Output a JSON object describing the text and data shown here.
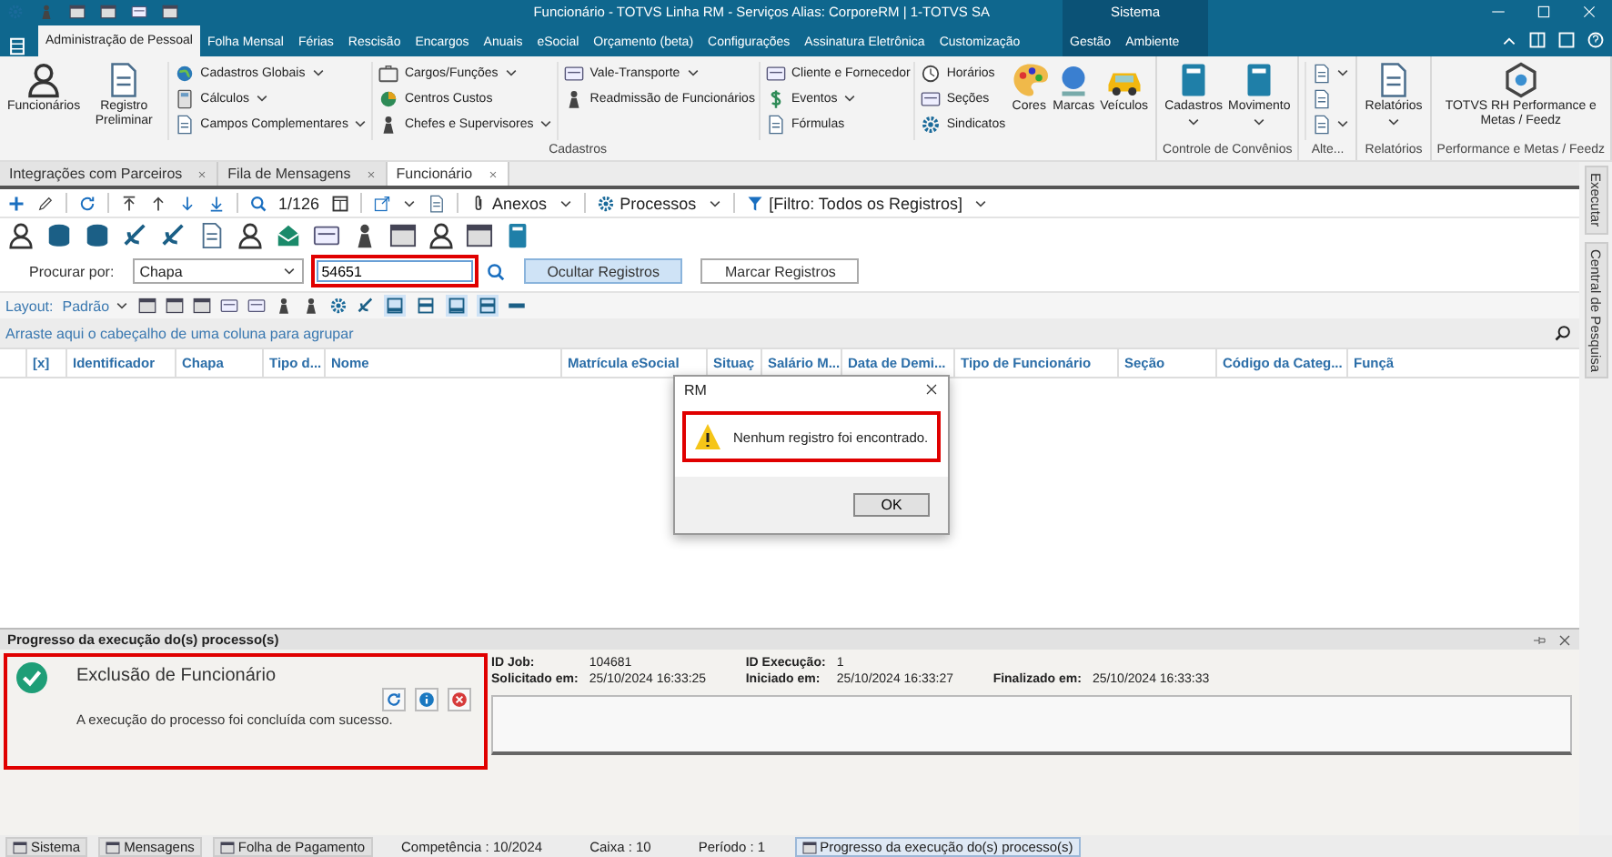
{
  "window": {
    "title": "Funcionário - TOTVS Linha RM - Serviços  Alias: CorporeRM | 1-TOTVS SA",
    "context_label": "Sistema"
  },
  "ribbon": {
    "tabs": [
      {
        "label": "Administração de Pessoal",
        "selected": true
      },
      {
        "label": "Folha Mensal",
        "selected": false
      },
      {
        "label": "Férias",
        "selected": false
      },
      {
        "label": "Rescisão",
        "selected": false
      },
      {
        "label": "Encargos",
        "selected": false
      },
      {
        "label": "Anuais",
        "selected": false
      },
      {
        "label": "eSocial",
        "selected": false
      },
      {
        "label": "Orçamento (beta)",
        "selected": false
      },
      {
        "label": "Configurações",
        "selected": false
      },
      {
        "label": "Assinatura Eletrônica",
        "selected": false
      },
      {
        "label": "Customização",
        "selected": false
      }
    ],
    "context_tabs": [
      {
        "label": "Gestão",
        "selected": false
      },
      {
        "label": "Ambiente",
        "selected": false
      }
    ],
    "groups": [
      {
        "label": "Cadastros",
        "columns": [
          {
            "kind": "large",
            "items": [
              {
                "label": "Funcionários",
                "dropdown": false
              },
              {
                "label": "Registro Preliminar",
                "dropdown": false
              }
            ]
          },
          {
            "kind": "small",
            "items": [
              {
                "label": "Cadastros Globais",
                "dropdown": true
              },
              {
                "label": "Cálculos",
                "dropdown": true
              },
              {
                "label": "Campos Complementares",
                "dropdown": true
              }
            ]
          },
          {
            "kind": "small",
            "items": [
              {
                "label": "Cargos/Funções",
                "dropdown": true
              },
              {
                "label": "Centros Custos",
                "dropdown": false
              },
              {
                "label": "Chefes e Supervisores",
                "dropdown": true
              }
            ]
          },
          {
            "kind": "small",
            "items": [
              {
                "label": "Vale-Transporte",
                "dropdown": true
              },
              {
                "label": "Readmissão de Funcionários",
                "dropdown": false
              }
            ]
          },
          {
            "kind": "small",
            "items": [
              {
                "label": "Cliente e Fornecedor",
                "dropdown": false
              },
              {
                "label": "Eventos",
                "dropdown": true
              },
              {
                "label": "Fórmulas",
                "dropdown": false
              }
            ]
          },
          {
            "kind": "small",
            "items": [
              {
                "label": "Horários",
                "dropdown": false
              },
              {
                "label": "Seções",
                "dropdown": false
              },
              {
                "label": "Sindicatos",
                "dropdown": false
              }
            ]
          },
          {
            "kind": "large",
            "items": [
              {
                "label": "Cores",
                "dropdown": false
              },
              {
                "label": "Marcas",
                "dropdown": false
              },
              {
                "label": "Veículos",
                "dropdown": false
              }
            ]
          }
        ]
      },
      {
        "label": "Controle de Convênios",
        "columns": [
          {
            "kind": "large",
            "items": [
              {
                "label": "Cadastros",
                "dropdown": true
              },
              {
                "label": "Movimento",
                "dropdown": true
              }
            ]
          }
        ]
      },
      {
        "label": "Alte...",
        "columns": [
          {
            "kind": "icons",
            "items": [
              {
                "dropdown": true
              },
              {
                "dropdown": false
              },
              {
                "dropdown": true
              }
            ]
          }
        ]
      },
      {
        "label": "Relatórios",
        "columns": [
          {
            "kind": "large",
            "items": [
              {
                "label": "Relatórios",
                "dropdown": true
              }
            ]
          }
        ]
      },
      {
        "label": "Performance e Metas / Feedz",
        "columns": [
          {
            "kind": "large",
            "items": [
              {
                "label": "TOTVS RH Performance e Metas / Feedz",
                "dropdown": false
              }
            ]
          }
        ]
      }
    ]
  },
  "document_tabs": [
    {
      "label": "Integrações com Parceiros",
      "selected": false
    },
    {
      "label": "Fila de Mensagens",
      "selected": false
    },
    {
      "label": "Funcionário",
      "selected": true
    }
  ],
  "toolbar": {
    "record_position": "1/126",
    "attachments": "Anexos",
    "processes": "Processos",
    "filter": "[Filtro: Todos os Registros]"
  },
  "search": {
    "label": "Procurar por:",
    "field": "Chapa",
    "value": "54651",
    "buttons": [
      {
        "label": "Ocultar Registros",
        "pressed": true
      },
      {
        "label": "Marcar Registros",
        "pressed": false
      }
    ]
  },
  "layout_bar": {
    "label": "Layout:",
    "preset": "Padrão",
    "view_toggles": [
      {
        "pressed": true
      },
      {
        "pressed": false
      },
      {
        "pressed": true
      },
      {
        "pressed": true
      }
    ]
  },
  "grid": {
    "group_hint": "Arraste aqui o cabeçalho de uma coluna para agrupar",
    "columns": [
      "[x]",
      "Identificador",
      "Chapa",
      "Tipo d...",
      "Nome",
      "Matrícula eSocial",
      "Situaç",
      "Salário M...",
      "Data de Demi...",
      "Tipo de Funcionário",
      "Seção",
      "Código da Categ...",
      "Funçã"
    ]
  },
  "side_panel": [
    "Executar",
    "Central de Pesquisa"
  ],
  "dialog": {
    "title": "RM",
    "message": "Nenhum registro foi encontrado.",
    "button": "OK"
  },
  "progress_panel": {
    "title": "Progresso da execução do(s) processo(s)",
    "process_name": "Exclusão de Funcionário",
    "status_message": "A execução do processo foi concluída com sucesso.",
    "details": [
      {
        "label": "ID Job:",
        "value": "104681"
      },
      {
        "label": "ID Execução:",
        "value": "1"
      },
      {
        "label": "Solicitado em:",
        "value": "25/10/2024 16:33:25"
      },
      {
        "label": "Iniciado em:",
        "value": "25/10/2024 16:33:27"
      },
      {
        "label": "Finalizado em:",
        "value": "25/10/2024 16:33:33"
      }
    ]
  },
  "status_bar": [
    {
      "kind": "tab",
      "label": "Sistema",
      "selected": false
    },
    {
      "kind": "tab",
      "label": "Mensagens",
      "selected": false
    },
    {
      "kind": "tab",
      "label": "Folha de Pagamento",
      "selected": false
    },
    {
      "kind": "info",
      "label": "Competência : 10/2024"
    },
    {
      "kind": "info",
      "label": "Caixa : 10"
    },
    {
      "kind": "info",
      "label": "Período : 1"
    },
    {
      "kind": "tab",
      "label": "Progresso da execução do(s) processo(s)",
      "selected": true
    }
  ]
}
